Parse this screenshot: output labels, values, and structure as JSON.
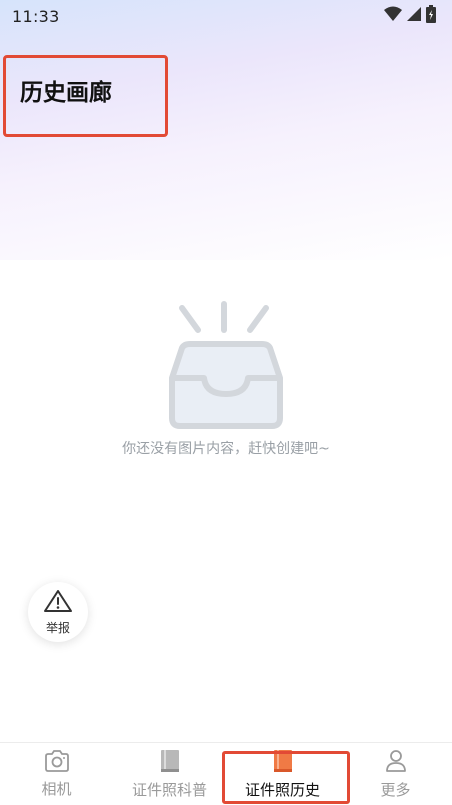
{
  "status_bar": {
    "time": "11:33",
    "icons": [
      "wifi-icon",
      "signal-icon",
      "battery-icon"
    ]
  },
  "header": {
    "title": "历史画廊"
  },
  "empty_state": {
    "icon": "empty-box-icon",
    "message": "你还没有图片内容，赶快创建吧~"
  },
  "report_button": {
    "icon": "warning-triangle-icon",
    "label": "举报"
  },
  "tabs": [
    {
      "label": "相机",
      "icon": "camera-icon",
      "active": false
    },
    {
      "label": "证件照科普",
      "icon": "book-icon",
      "active": false
    },
    {
      "label": "证件照历史",
      "icon": "book-icon",
      "active": true
    },
    {
      "label": "更多",
      "icon": "person-icon",
      "active": false
    }
  ],
  "colors": {
    "accent_orange": "#f07a45",
    "highlight_red": "#e24a35",
    "muted_gray": "#9aa0a6"
  }
}
